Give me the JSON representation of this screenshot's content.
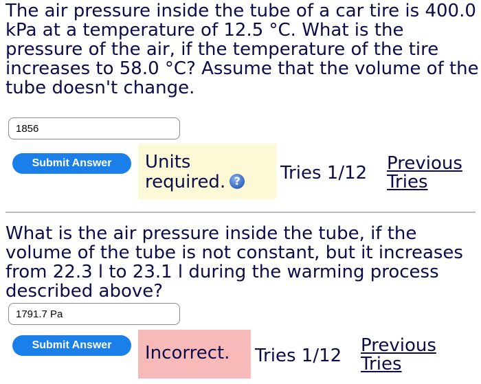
{
  "question1": {
    "text": "The air pressure inside the tube of a car tire is 400.0 kPa at a temperature of 12.5 °C. What is the pressure of the air, if the temperature of the tire increases to 58.0 °C? Assume that the volume of the tube doesn't change.",
    "answer_value": "1856",
    "submit_label": "Submit Answer",
    "feedback_text": "Units required.",
    "feedback_color": "#fdf9d7",
    "tries_text": "Tries 1/12",
    "previous_tries_line1": "Previous",
    "previous_tries_line2": "Tries",
    "help_icon": "help-icon"
  },
  "question2": {
    "text": "What is the air pressure inside the tube, if the volume of the tube is not constant, but it increases from 22.3 l to 23.1 l during the warming process described above?",
    "answer_value": "1791.7 Pa",
    "submit_label": "Submit Answer",
    "feedback_text": "Incorrect.",
    "feedback_color": "#f8b9b9",
    "tries_text": "Tries 1/12",
    "previous_tries_line1": "Previous",
    "previous_tries_line2": "Tries"
  },
  "colors": {
    "text": "#0b0b4a",
    "button": "#1a7fe8",
    "divider": "#b9b9b9"
  }
}
